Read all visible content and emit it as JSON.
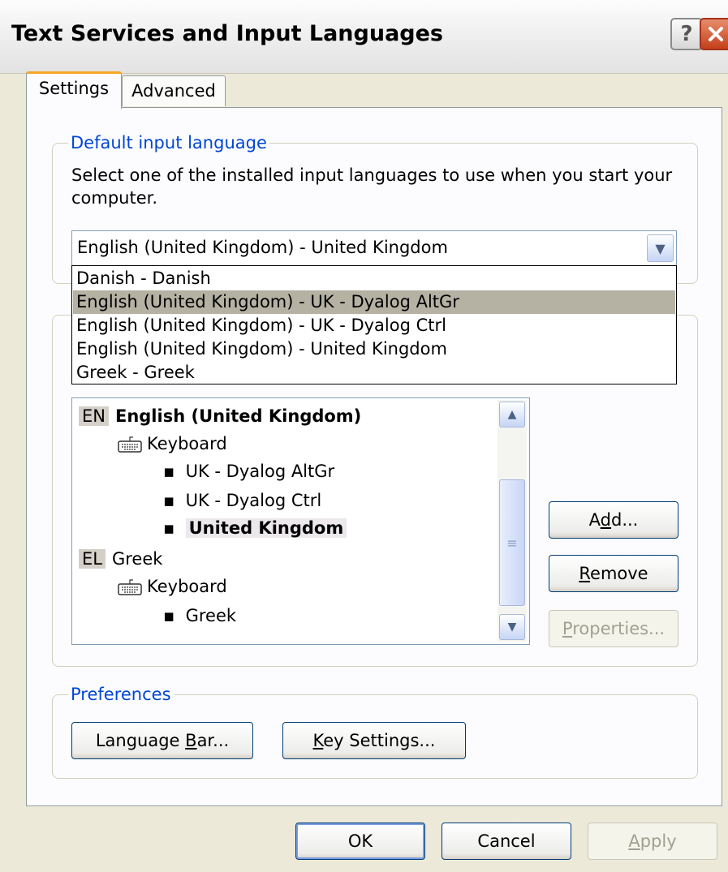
{
  "window": {
    "title": "Text Services and Input Languages"
  },
  "titlebar": {
    "help_label": "?",
    "close_label": "✕"
  },
  "tabs": [
    {
      "label": "Settings"
    },
    {
      "label": "Advanced"
    }
  ],
  "default_input": {
    "legend": "Default input language",
    "description_line1": "Select one of the installed input languages to use when you start your",
    "description_line2": "computer.",
    "selected": "English (United Kingdom) - United Kingdom",
    "options": [
      "Danish - Danish",
      "English (United Kingdom) - UK - Dyalog AltGr",
      "English (United Kingdom) - UK - Dyalog Ctrl",
      "English (United Kingdom) - United Kingdom",
      "Greek - Greek"
    ]
  },
  "tree": {
    "lang1_badge": "EN",
    "lang1_name": "English (United Kingdom)",
    "lang1_keyboard": "Keyboard",
    "lang1_items": [
      "UK - Dyalog AltGr",
      "UK - Dyalog Ctrl",
      "United Kingdom"
    ],
    "lang2_badge": "EL",
    "lang2_name": "Greek",
    "lang2_keyboard": "Keyboard",
    "lang2_items": [
      "Greek"
    ]
  },
  "side_buttons": {
    "add_pre": "A",
    "add_u": "d",
    "add_post": "d...",
    "remove_u": "R",
    "remove_post": "emove",
    "properties_u": "P",
    "properties_post": "roperties..."
  },
  "preferences": {
    "legend": "Preferences",
    "langbar_pre": "Language ",
    "langbar_u": "B",
    "langbar_post": "ar...",
    "keysettings_u": "K",
    "keysettings_post": "ey Settings..."
  },
  "footer": {
    "ok": "OK",
    "cancel": "Cancel",
    "apply_u": "A",
    "apply_post": "pply"
  },
  "colors": {
    "accent": "#0046d5",
    "tab_highlight": "#f5a623",
    "selection": "#b5b2a4"
  }
}
